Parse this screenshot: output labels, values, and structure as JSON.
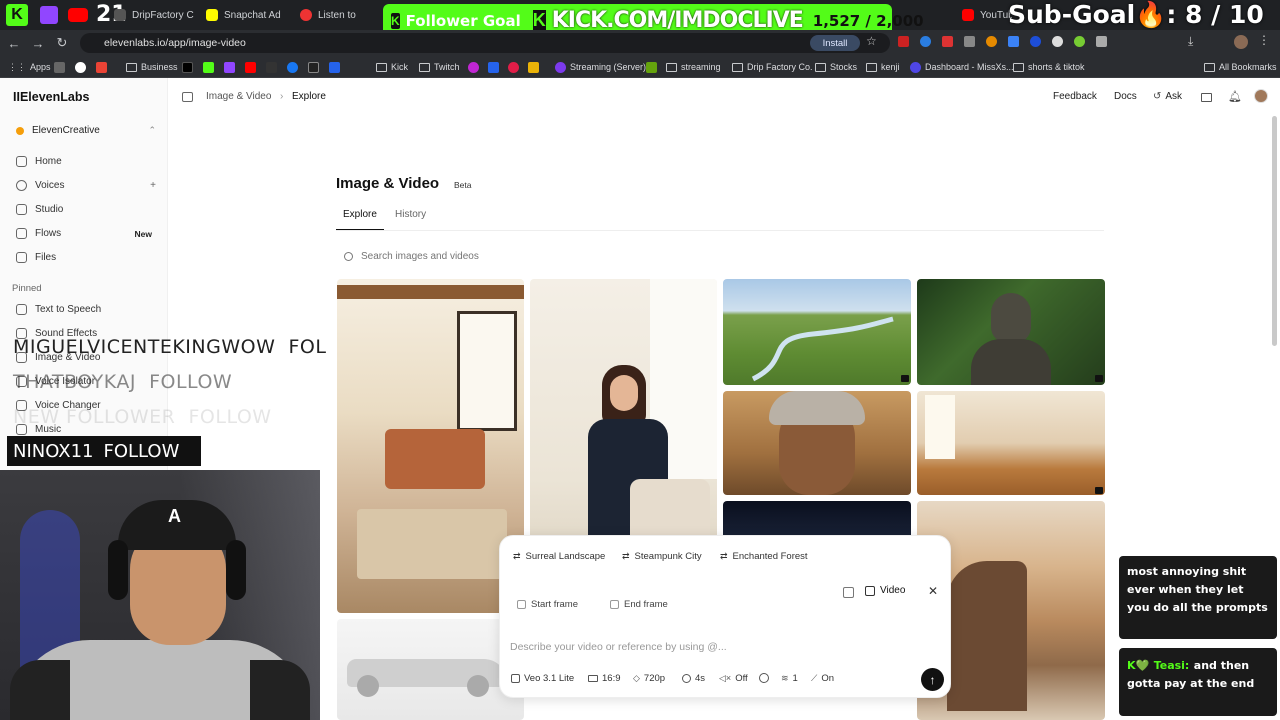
{
  "browser": {
    "tabs": [
      {
        "label": "DripFactory C"
      },
      {
        "label": "Snapchat Ad"
      },
      {
        "label": "Listen to"
      },
      {
        "label": "YouTube"
      }
    ],
    "url": "elevenlabs.io/app/image-video",
    "install_label": "Install",
    "bookmarks": [
      "Apps",
      "Business",
      "Kick",
      "Twitch",
      "Streaming (Server)",
      "streaming",
      "Drip Factory Co.",
      "Stocks",
      "kenji",
      "Dashboard - MissXs...",
      "shorts & tiktok",
      "All Bookmarks"
    ]
  },
  "stream_overlay": {
    "kick_count": "21",
    "follower_goal_label": "Follower Goal",
    "follower_goal_url": "KICK.COM/IMDOCLIVE",
    "follower_goal_progress": "1,527 / 2,000",
    "sub_goal": "Sub-Goal🔥: 8 / 10",
    "follow_names": [
      "MIGUELVICENTEKINGWOW",
      "THATBOYKAJ",
      "NEW FOLLOWER"
    ],
    "follow_word": "FOLLOW",
    "follow_tail": "FOL",
    "current_follow_name": "NINOX11",
    "chat": [
      {
        "user": "",
        "text": "most annoying shit ever when they let you do all the prompts"
      },
      {
        "user": "Teasi:",
        "text": "and then gotta pay at the end"
      }
    ],
    "colors": {
      "accent_green": "#53fc18",
      "dark": "#111111"
    }
  },
  "app": {
    "brand": "IIElevenLabs",
    "workspace": "ElevenCreative",
    "breadcrumb": {
      "parent": "Image & Video",
      "current": "Explore"
    },
    "header_actions": {
      "feedback": "Feedback",
      "docs": "Docs",
      "ask": "Ask"
    },
    "nav": [
      {
        "label": "Home",
        "icon": "home-icon"
      },
      {
        "label": "Voices",
        "icon": "voices-icon",
        "extra": "+"
      },
      {
        "label": "Studio",
        "icon": "studio-icon"
      },
      {
        "label": "Flows",
        "icon": "flows-icon",
        "badge": "New"
      },
      {
        "label": "Files",
        "icon": "files-icon"
      }
    ],
    "pinned_title": "Pinned",
    "pinned": [
      {
        "label": "Text to Speech"
      },
      {
        "label": "Sound Effects"
      },
      {
        "label": "Image & Video"
      },
      {
        "label": "Voice Isolator"
      },
      {
        "label": "Voice Changer"
      },
      {
        "label": "Music"
      }
    ],
    "page_title": "Image & Video",
    "beta_badge": "Beta",
    "tabs": [
      {
        "label": "Explore"
      },
      {
        "label": "History"
      }
    ],
    "search_placeholder": "Search images and videos",
    "composer": {
      "suggestions": [
        "Surreal Landscape",
        "Steampunk City",
        "Enchanted Forest"
      ],
      "start_frame": "Start frame",
      "end_frame": "End frame",
      "mode": "Video",
      "placeholder": "Describe your video or reference by using @...",
      "model": "Veo 3.1 Lite",
      "aspect": "16:9",
      "resolution": "720p",
      "duration": "4s",
      "audio": "Off",
      "count": "1",
      "enhance": "On"
    }
  }
}
